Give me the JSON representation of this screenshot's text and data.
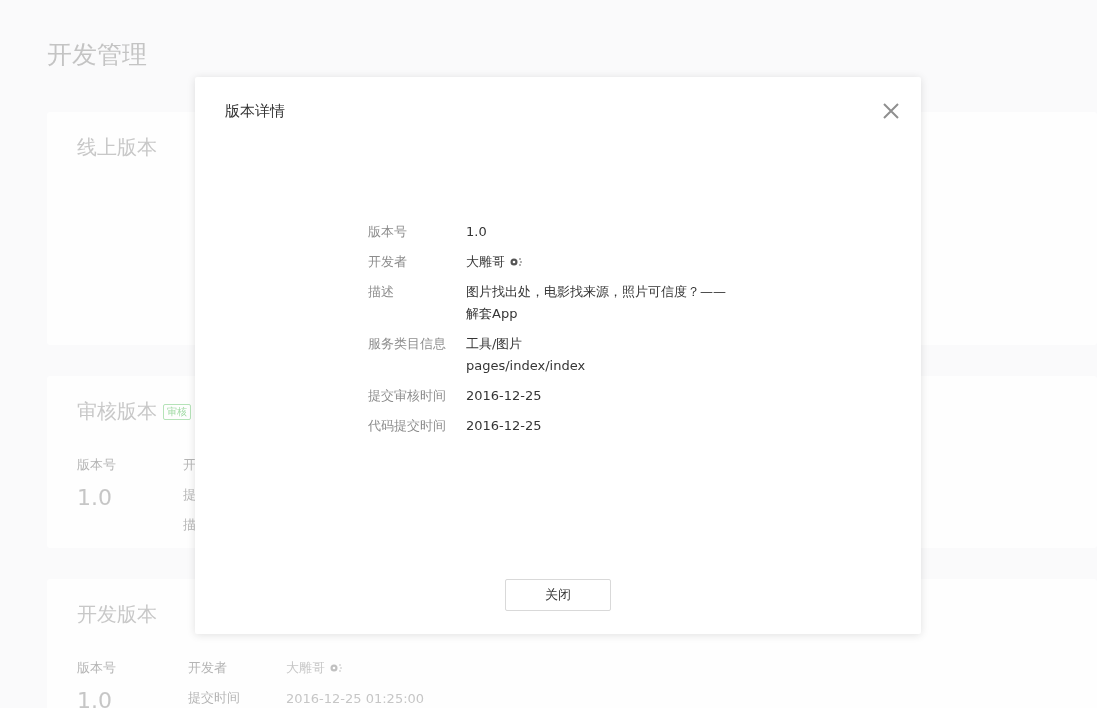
{
  "page": {
    "title": "开发管理"
  },
  "sections": [
    {
      "kind": "online",
      "title": "线上版本"
    },
    {
      "kind": "review",
      "title": "审核版本",
      "badge": "审核",
      "version_label": "版本号",
      "version": "1.0",
      "fields": [
        {
          "label": "开"
        },
        {
          "label": "提"
        },
        {
          "label": "描"
        }
      ]
    },
    {
      "kind": "dev",
      "title": "开发版本",
      "version_label": "版本号",
      "version": "1.0",
      "fields": [
        {
          "label": "开发者",
          "value": "大雕哥",
          "avatar_glyph": true
        },
        {
          "label": "提交时间",
          "value": "2016-12-25 01:25:00"
        }
      ]
    }
  ],
  "dialog": {
    "title": "版本详情",
    "rows": [
      {
        "label": "版本号",
        "lines": [
          "1.0"
        ]
      },
      {
        "label": "开发者",
        "lines": [
          "大雕哥"
        ],
        "avatar_glyph": true
      },
      {
        "label": "描述",
        "lines": [
          "图片找出处，电影找来源，照片可信度？——",
          "解套App"
        ]
      },
      {
        "label": "服务类目信息",
        "lines": [
          "工具/图片",
          "pages/index/index"
        ]
      },
      {
        "label": "提交审核时间",
        "lines": [
          "2016-12-25"
        ]
      },
      {
        "label": "代码提交时间",
        "lines": [
          "2016-12-25"
        ]
      }
    ],
    "button": "关闭"
  }
}
